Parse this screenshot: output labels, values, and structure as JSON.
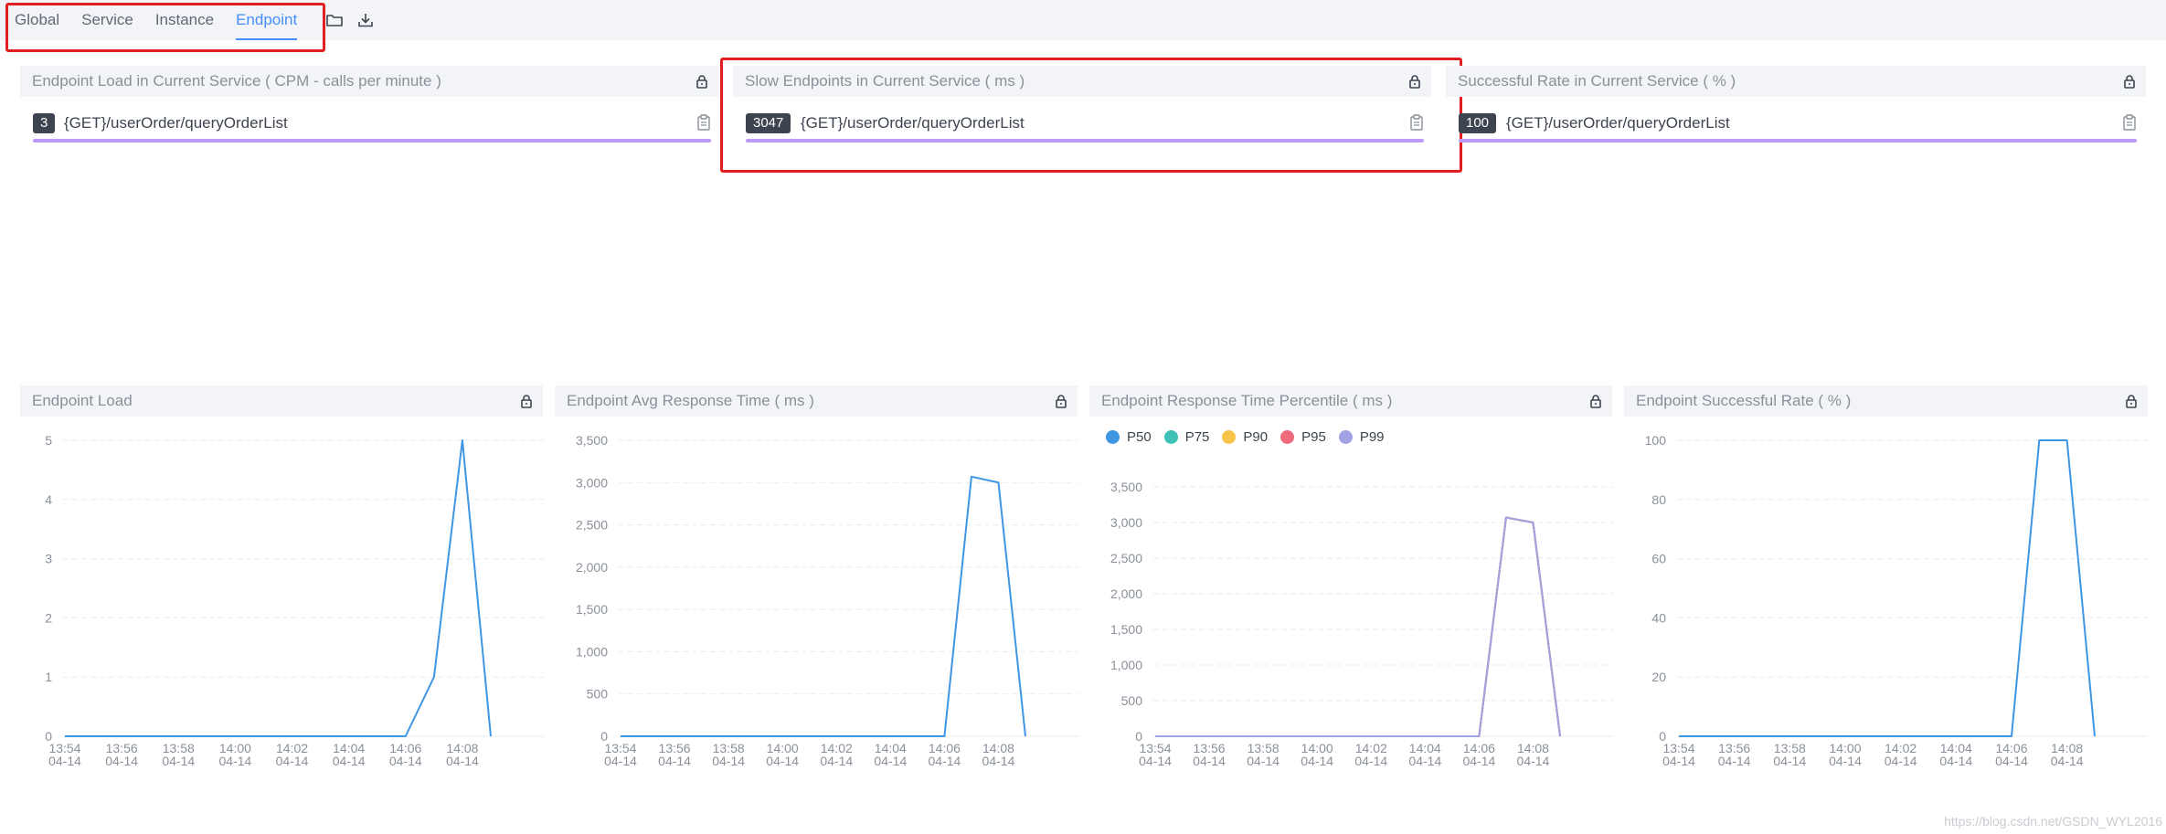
{
  "tabs": [
    {
      "label": "Global",
      "active": false
    },
    {
      "label": "Service",
      "active": false
    },
    {
      "label": "Instance",
      "active": false
    },
    {
      "label": "Endpoint",
      "active": true
    }
  ],
  "toolbar": {
    "folder_icon": "folder-icon",
    "download_icon": "download-icon"
  },
  "list_panels": [
    {
      "title": "Endpoint Load in Current Service ( CPM - calls per minute )",
      "value": "3",
      "endpoint": "{GET}/userOrder/queryOrderList"
    },
    {
      "title": "Slow Endpoints in Current Service ( ms )",
      "value": "3047",
      "endpoint": "{GET}/userOrder/queryOrderList"
    },
    {
      "title": "Successful Rate in Current Service ( % )",
      "value": "100",
      "endpoint": "{GET}/userOrder/queryOrderList"
    }
  ],
  "colors": {
    "accent": "#448dfe",
    "bar": "#bf99f8",
    "line": "#3f96e3",
    "highlight": "#e02020"
  },
  "chart_data": [
    {
      "type": "line",
      "title": "Endpoint Load",
      "categories": [
        "13:54",
        "13:55",
        "13:56",
        "13:57",
        "13:58",
        "13:59",
        "14:00",
        "14:01",
        "14:02",
        "14:03",
        "14:04",
        "14:05",
        "14:06",
        "14:07",
        "14:08",
        "14:09"
      ],
      "tick_labels": [
        [
          "13:54",
          "04-14"
        ],
        [
          "13:56",
          "04-14"
        ],
        [
          "13:58",
          "04-14"
        ],
        [
          "14:00",
          "04-14"
        ],
        [
          "14:02",
          "04-14"
        ],
        [
          "14:04",
          "04-14"
        ],
        [
          "14:06",
          "04-14"
        ],
        [
          "14:08",
          "04-14"
        ]
      ],
      "yticks": [
        "0",
        "1",
        "2",
        "3",
        "4",
        "5"
      ],
      "ylim": [
        0,
        5
      ],
      "series": [
        {
          "values": [
            0,
            0,
            0,
            0,
            0,
            0,
            0,
            0,
            0,
            0,
            0,
            0,
            0,
            1,
            5,
            0
          ],
          "color": "#3f96e3"
        }
      ]
    },
    {
      "type": "line",
      "title": "Endpoint Avg Response Time ( ms )",
      "categories": [
        "13:54",
        "13:55",
        "13:56",
        "13:57",
        "13:58",
        "13:59",
        "14:00",
        "14:01",
        "14:02",
        "14:03",
        "14:04",
        "14:05",
        "14:06",
        "14:07",
        "14:08",
        "14:09"
      ],
      "tick_labels": [
        [
          "13:54",
          "04-14"
        ],
        [
          "13:56",
          "04-14"
        ],
        [
          "13:58",
          "04-14"
        ],
        [
          "14:00",
          "04-14"
        ],
        [
          "14:02",
          "04-14"
        ],
        [
          "14:04",
          "04-14"
        ],
        [
          "14:06",
          "04-14"
        ],
        [
          "14:08",
          "04-14"
        ]
      ],
      "yticks": [
        "0",
        "500",
        "1,000",
        "1,500",
        "2,000",
        "2,500",
        "3,000",
        "3,500"
      ],
      "ylim": [
        0,
        3500
      ],
      "series": [
        {
          "values": [
            0,
            0,
            0,
            0,
            0,
            0,
            0,
            0,
            0,
            0,
            0,
            0,
            0,
            3070,
            3000,
            0
          ],
          "color": "#3f96e3"
        }
      ]
    },
    {
      "type": "line",
      "title": "Endpoint Response Time Percentile ( ms )",
      "categories": [
        "13:54",
        "13:55",
        "13:56",
        "13:57",
        "13:58",
        "13:59",
        "14:00",
        "14:01",
        "14:02",
        "14:03",
        "14:04",
        "14:05",
        "14:06",
        "14:07",
        "14:08",
        "14:09"
      ],
      "tick_labels": [
        [
          "13:54",
          "04-14"
        ],
        [
          "13:56",
          "04-14"
        ],
        [
          "13:58",
          "04-14"
        ],
        [
          "14:00",
          "04-14"
        ],
        [
          "14:02",
          "04-14"
        ],
        [
          "14:04",
          "04-14"
        ],
        [
          "14:06",
          "04-14"
        ],
        [
          "14:08",
          "04-14"
        ]
      ],
      "yticks": [
        "0",
        "500",
        "1,000",
        "1,500",
        "2,000",
        "2,500",
        "3,000",
        "3,500"
      ],
      "ylim": [
        0,
        3500
      ],
      "legend": [
        {
          "name": "P50",
          "color": "#3f96e3"
        },
        {
          "name": "P75",
          "color": "#3fc2b6"
        },
        {
          "name": "P90",
          "color": "#f8c54b"
        },
        {
          "name": "P95",
          "color": "#ee6b7c"
        },
        {
          "name": "P99",
          "color": "#a3a3e4"
        }
      ],
      "series": [
        {
          "name": "P50",
          "values": [
            0,
            0,
            0,
            0,
            0,
            0,
            0,
            0,
            0,
            0,
            0,
            0,
            0,
            3070,
            3000,
            0
          ],
          "color": "#3f96e3"
        },
        {
          "name": "P75",
          "values": [
            0,
            0,
            0,
            0,
            0,
            0,
            0,
            0,
            0,
            0,
            0,
            0,
            0,
            3070,
            3000,
            0
          ],
          "color": "#3fc2b6"
        },
        {
          "name": "P90",
          "values": [
            0,
            0,
            0,
            0,
            0,
            0,
            0,
            0,
            0,
            0,
            0,
            0,
            0,
            3070,
            3000,
            0
          ],
          "color": "#f8c54b"
        },
        {
          "name": "P95",
          "values": [
            0,
            0,
            0,
            0,
            0,
            0,
            0,
            0,
            0,
            0,
            0,
            0,
            0,
            3070,
            3000,
            0
          ],
          "color": "#ee6b7c"
        },
        {
          "name": "P99",
          "values": [
            0,
            0,
            0,
            0,
            0,
            0,
            0,
            0,
            0,
            0,
            0,
            0,
            0,
            3070,
            3000,
            0
          ],
          "color": "#a3a3e4"
        }
      ]
    },
    {
      "type": "line",
      "title": "Endpoint Successful Rate ( % )",
      "categories": [
        "13:54",
        "13:55",
        "13:56",
        "13:57",
        "13:58",
        "13:59",
        "14:00",
        "14:01",
        "14:02",
        "14:03",
        "14:04",
        "14:05",
        "14:06",
        "14:07",
        "14:08",
        "14:09"
      ],
      "tick_labels": [
        [
          "13:54",
          "04-14"
        ],
        [
          "13:56",
          "04-14"
        ],
        [
          "13:58",
          "04-14"
        ],
        [
          "14:00",
          "04-14"
        ],
        [
          "14:02",
          "04-14"
        ],
        [
          "14:04",
          "04-14"
        ],
        [
          "14:06",
          "04-14"
        ],
        [
          "14:08",
          "04-14"
        ]
      ],
      "yticks": [
        "0",
        "20",
        "40",
        "60",
        "80",
        "100"
      ],
      "ylim": [
        0,
        100
      ],
      "series": [
        {
          "values": [
            0,
            0,
            0,
            0,
            0,
            0,
            0,
            0,
            0,
            0,
            0,
            0,
            0,
            100,
            100,
            0
          ],
          "color": "#3f96e3"
        }
      ]
    }
  ],
  "watermark": "https://blog.csdn.net/GSDN_WYL2016"
}
